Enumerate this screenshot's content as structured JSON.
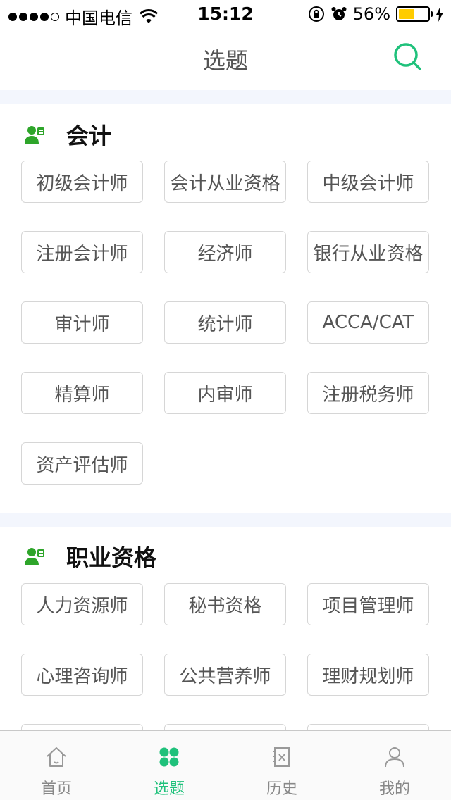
{
  "status_bar": {
    "carrier": "中国电信",
    "time": "15:12",
    "battery": "56%",
    "battery_level": 0.56
  },
  "nav": {
    "title": "选题"
  },
  "sections": [
    {
      "title": "会计",
      "items": [
        "初级会计师",
        "会计从业资格",
        "中级会计师",
        "注册会计师",
        "经济师",
        "银行从业资格",
        "审计师",
        "统计师",
        "ACCA/CAT",
        "精算师",
        "内审师",
        "注册税务师",
        "资产评估师"
      ]
    },
    {
      "title": "职业资格",
      "items": [
        "人力资源师",
        "秘书资格",
        "项目管理师",
        "心理咨询师",
        "公共营养师",
        "理财规划师"
      ]
    }
  ],
  "tabs": [
    {
      "label": "首页",
      "icon": "home-icon"
    },
    {
      "label": "选题",
      "icon": "grid-icon"
    },
    {
      "label": "历史",
      "icon": "history-icon"
    },
    {
      "label": "我的",
      "icon": "user-icon"
    }
  ],
  "colors": {
    "accent": "#1fc17b",
    "section_icon": "#2ea52a",
    "gap_bg": "#f3f6fd"
  }
}
